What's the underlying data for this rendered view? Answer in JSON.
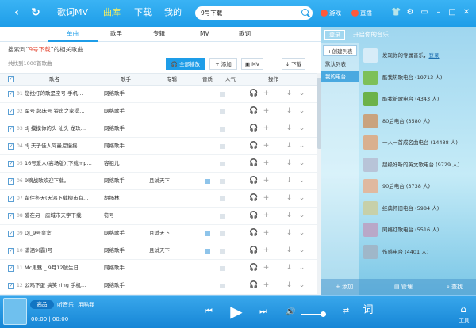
{
  "header": {
    "nav": [
      {
        "label": "歌词MV"
      },
      {
        "label": "曲库"
      },
      {
        "label": "下载"
      },
      {
        "label": "我的"
      }
    ],
    "search_value": "9号下载",
    "links": [
      {
        "label": "游戏"
      },
      {
        "label": "直播"
      }
    ]
  },
  "tabs": [
    "单曲",
    "歌手",
    "专辑",
    "MV",
    "歌词"
  ],
  "result": {
    "prefix": "搜索到“",
    "keyword": "9号下载",
    "suffix": "”的相关歌曲"
  },
  "total_text": "共找到1000首歌曲",
  "toolbar": {
    "play_all": "全部播放",
    "add": "添加",
    "mv": "MV",
    "download": "下载"
  },
  "columns": {
    "name": "歌名",
    "artist": "歌手",
    "album": "专辑",
    "quality": "音质",
    "popularity": "人气",
    "actions": "操作"
  },
  "songs": [
    {
      "num": "01",
      "name": "您找打的歌是空号 手机…",
      "artist": "网络歌手",
      "album": ""
    },
    {
      "num": "02",
      "name": "军号 起床号 铃声之家提…",
      "artist": "网络歌手",
      "album": ""
    },
    {
      "num": "03",
      "name": "dj 摸摸你的头 汕头 龙珠…",
      "artist": "网络歌手",
      "album": ""
    },
    {
      "num": "04",
      "name": "dj 天子佳人阿曼尼慢摇…",
      "artist": "网络歌手",
      "album": ""
    },
    {
      "num": "05",
      "name": "16号爱人(高场版)(下载mp…",
      "artist": "容祖儿",
      "album": ""
    },
    {
      "num": "06",
      "name": "9嘀战歌欢迎下载。",
      "artist": "网络歌手",
      "album": "且试天下"
    },
    {
      "num": "07",
      "name": "留住冬天(天鸿下载柳市有…",
      "artist": "胡扬林",
      "album": ""
    },
    {
      "num": "08",
      "name": "爱在另一座城市天宇下载",
      "artist": "符号",
      "album": ""
    },
    {
      "num": "09",
      "name": "DJ_9号皇室",
      "artist": "网络歌手",
      "album": "且试天下"
    },
    {
      "num": "10",
      "name": "潇洒9(霸)号",
      "artist": "网络歌手",
      "album": "且试天下"
    },
    {
      "num": "11",
      "name": "Mc鬼魅 _ 9月12號生日",
      "artist": "网络歌手",
      "album": ""
    },
    {
      "num": "12",
      "name": "公鸡下蛋 搞笑 ring 手机…",
      "artist": "网络歌手",
      "album": ""
    }
  ],
  "right": {
    "login": "登录",
    "unlock": "开启你的音乐",
    "create": "+创建列表",
    "menu": [
      "默认列表",
      "我的电台"
    ],
    "radios": [
      {
        "prefix": "发现你的专属音乐，",
        "link": "登录"
      },
      {
        "prefix": "酷我热歌电台 (19713 人)",
        "link": ""
      },
      {
        "prefix": "酷我新歌电台 (4343 人)",
        "link": ""
      },
      {
        "prefix": "80后电台 (3580 人)",
        "link": ""
      },
      {
        "prefix": "一人一首成名曲电台 (14488 人)",
        "link": ""
      },
      {
        "prefix": "超级好听的英文歌电台 (9729 人)",
        "link": ""
      },
      {
        "prefix": "90后电台 (3738 人)",
        "link": ""
      },
      {
        "prefix": "经典怀旧电台 (5984 人)",
        "link": ""
      },
      {
        "prefix": "网络红歌电台 (5516 人)",
        "link": ""
      },
      {
        "prefix": "伤感电台 (4401 人)",
        "link": ""
      }
    ],
    "bottom": {
      "add": "添加",
      "manage": "管理",
      "find": "查找"
    }
  },
  "player": {
    "quality": "高品",
    "listen": "听音乐",
    "brand": "用酷我",
    "time": "00:00 | 00:00",
    "lyric_btn": "词",
    "tools": "工具"
  }
}
